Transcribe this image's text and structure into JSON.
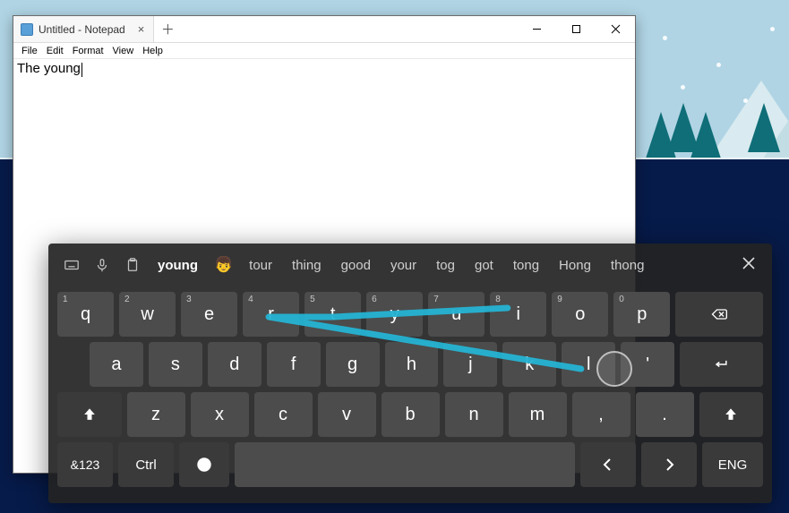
{
  "window": {
    "tab_title": "Untitled - Notepad",
    "menus": [
      "File",
      "Edit",
      "Format",
      "View",
      "Help"
    ],
    "editor_text": "The young"
  },
  "osk": {
    "suggestions_primary": "young",
    "emoji": "👦",
    "suggestions": [
      "tour",
      "thing",
      "good",
      "your",
      "tog",
      "got",
      "tong",
      "Hong",
      "thong"
    ],
    "row1": [
      {
        "n": "1",
        "k": "q"
      },
      {
        "n": "2",
        "k": "w"
      },
      {
        "n": "3",
        "k": "e"
      },
      {
        "n": "4",
        "k": "r"
      },
      {
        "n": "5",
        "k": "t"
      },
      {
        "n": "6",
        "k": "y"
      },
      {
        "n": "7",
        "k": "u"
      },
      {
        "n": "8",
        "k": "i"
      },
      {
        "n": "9",
        "k": "o"
      },
      {
        "n": "0",
        "k": "p"
      }
    ],
    "row2": [
      "a",
      "s",
      "d",
      "f",
      "g",
      "h",
      "j",
      "k",
      "l",
      "'"
    ],
    "row3": [
      "z",
      "x",
      "c",
      "v",
      "b",
      "n",
      "m",
      ",",
      "."
    ],
    "sym_label": "&123",
    "ctrl_label": "Ctrl",
    "lang_label": "ENG"
  }
}
